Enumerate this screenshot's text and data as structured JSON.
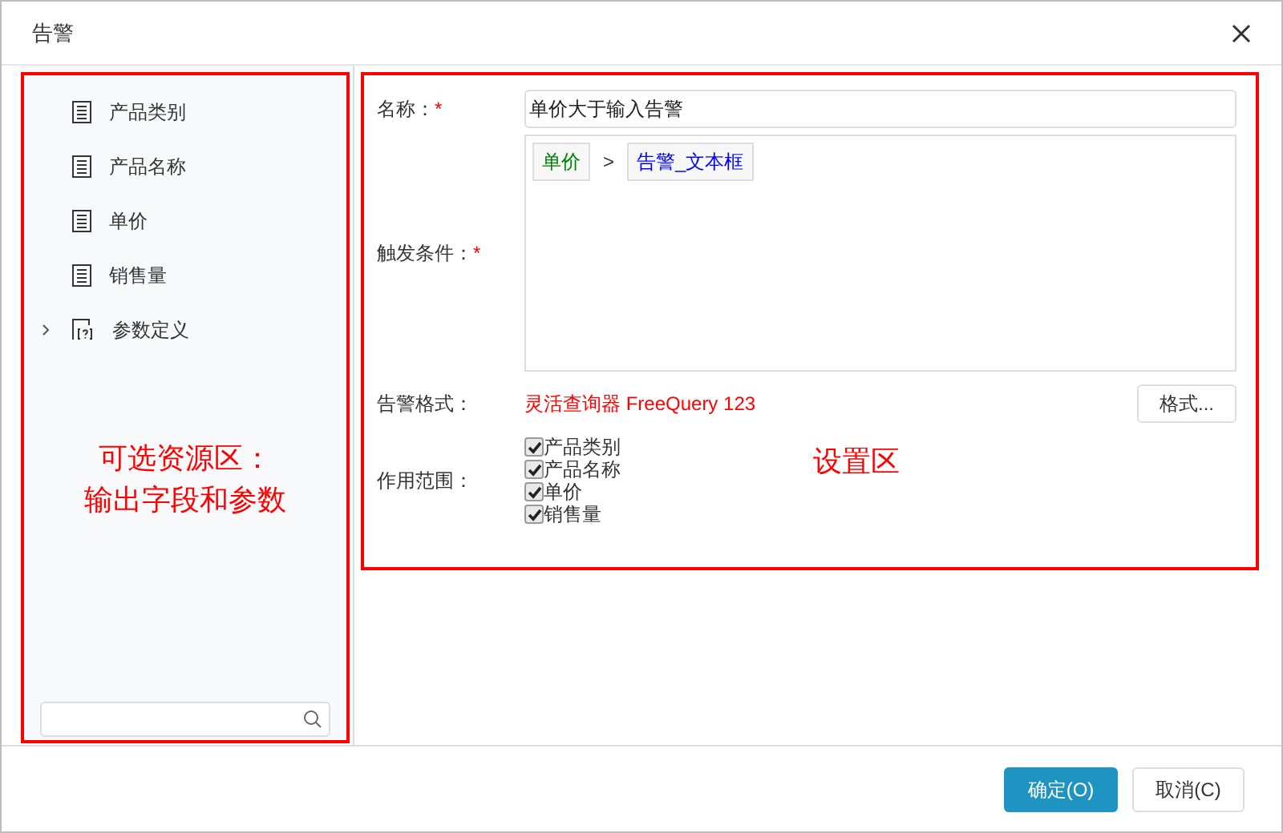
{
  "window": {
    "title": "告警"
  },
  "resources": {
    "items": [
      {
        "kind": "field",
        "label": "产品类别"
      },
      {
        "kind": "field",
        "label": "产品名称"
      },
      {
        "kind": "field",
        "label": "单价"
      },
      {
        "kind": "field",
        "label": "销售量"
      },
      {
        "kind": "param",
        "label": "参数定义",
        "expanded": false
      }
    ],
    "annotation": [
      "可选资源区：",
      "输出字段和参数"
    ]
  },
  "settings": {
    "name": {
      "label": "名称：",
      "required_mark": "*",
      "value": "单价大于输入告警"
    },
    "condition": {
      "label": "触发条件：",
      "required_mark": "*",
      "left": "单价",
      "operator": ">",
      "right": "告警_文本框"
    },
    "format": {
      "label": "告警格式：",
      "preview": "灵活查询器 FreeQuery 123",
      "button": "格式..."
    },
    "scope": {
      "label": "作用范围：",
      "items": [
        {
          "label": "产品类别",
          "checked": true
        },
        {
          "label": "产品名称",
          "checked": true
        },
        {
          "label": "单价",
          "checked": true
        },
        {
          "label": "销售量",
          "checked": true
        }
      ]
    },
    "annotation": "设置区"
  },
  "buttons": [
    {
      "label": "确定(O)",
      "kind": "primary"
    },
    {
      "label": "取消(C)",
      "kind": "secondary"
    }
  ]
}
